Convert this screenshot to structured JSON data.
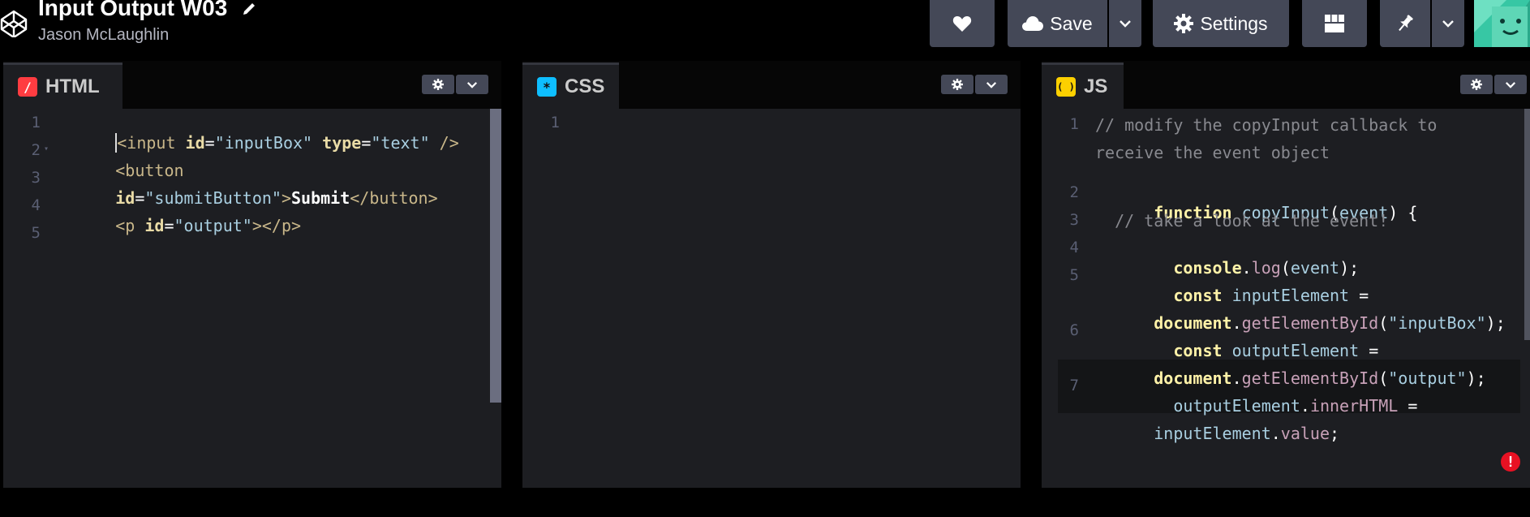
{
  "header": {
    "title": "Input Output W03",
    "author": "Jason McLaughlin",
    "buttons": {
      "heart_icon": "heart-icon",
      "save_label": "Save",
      "settings_label": "Settings"
    }
  },
  "panes": {
    "html": {
      "label": "HTML",
      "badge": "/",
      "badge_color": "#ff3c41",
      "line_numbers": [
        "1",
        "2",
        "3",
        "4",
        "5"
      ]
    },
    "css": {
      "label": "CSS",
      "badge": "*",
      "badge_color": "#0ebeff",
      "line_numbers": [
        "1"
      ]
    },
    "js": {
      "label": "JS",
      "badge": "( )",
      "badge_color": "#fcd000",
      "line_numbers": [
        "1",
        "2",
        "3",
        "4",
        "5",
        "6",
        "7"
      ]
    }
  },
  "code": {
    "html": {
      "l1": {
        "open": "<input ",
        "a1": "id",
        "eq1": "=",
        "v1": "\"inputBox\"",
        "sp": " ",
        "a2": "type",
        "eq2": "=",
        "v2": "\"text\"",
        "close": " />"
      },
      "l2": {
        "open": "<button"
      },
      "l3": {
        "a1": "id",
        "eq1": "=",
        "v1": "\"submitButton\"",
        "gt": ">",
        "text": "Submit",
        "close": "</button>"
      },
      "l4": {
        "open": "<p ",
        "a1": "id",
        "eq1": "=",
        "v1": "\"output\"",
        "close": "></p>"
      }
    },
    "js": {
      "l1a": "// modify the copyInput callback to",
      "l1b": "receive the event object",
      "l2": {
        "kw": "function",
        "sp": " ",
        "fn": "copyInput",
        "p1": "(",
        "arg": "event",
        "p2": ") {"
      },
      "l3": "  // take a look at the event!",
      "l4": {
        "indent": "  ",
        "obj": "console",
        "dot": ".",
        "m": "log",
        "p1": "(",
        "arg": "event",
        "p2": ");"
      },
      "l5a": {
        "indent": "  ",
        "kw": "const",
        "sp": " ",
        "var": "inputElement",
        "eq": " ="
      },
      "l5b": {
        "obj": "document",
        "dot": ".",
        "m": "getElementById",
        "p1": "(",
        "s": "\"inputBox\"",
        "p2": ");"
      },
      "l6a": {
        "indent": "  ",
        "kw": "const",
        "sp": " ",
        "var": "outputElement",
        "eq": " ="
      },
      "l6b": {
        "obj": "document",
        "dot": ".",
        "m": "getElementById",
        "p1": "(",
        "s": "\"output\"",
        "p2": ");"
      },
      "l7a": {
        "indent": "  ",
        "var": "outputElement",
        "dot": ".",
        "m": "innerHTML",
        "eq": " ="
      },
      "l7b": {
        "var": "inputElement",
        "dot": ".",
        "m": "value",
        "end": ";"
      }
    }
  },
  "colors": {
    "accent_red": "#ff3c41",
    "accent_blue": "#0ebeff",
    "accent_yellow": "#fcd000",
    "button_bg": "#444857",
    "editor_bg": "#1d1e22",
    "error_red": "#e81123"
  }
}
